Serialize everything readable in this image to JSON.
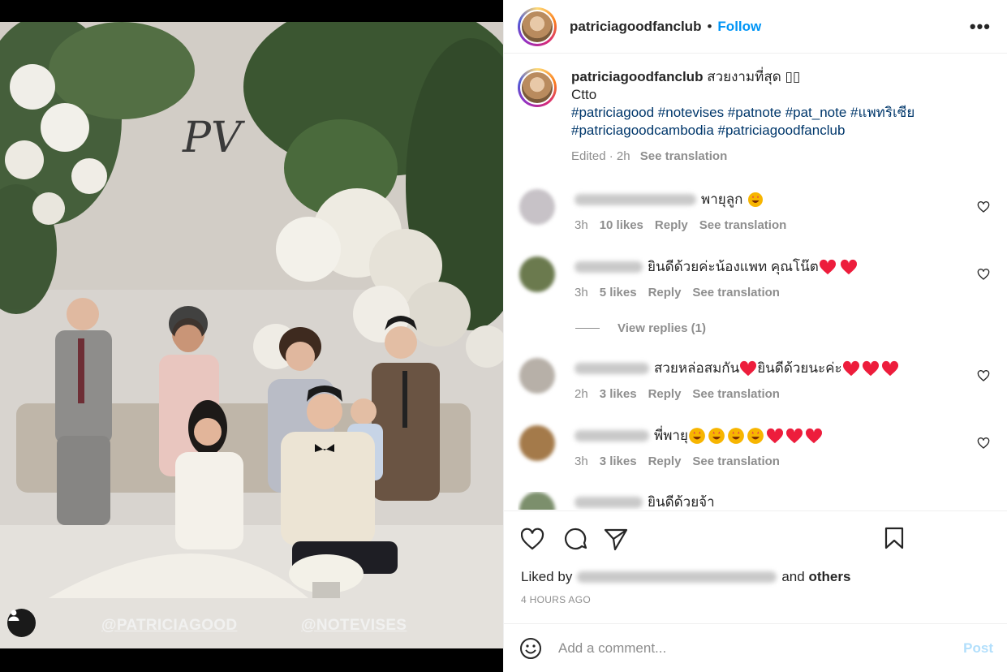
{
  "header": {
    "username": "patriciagoodfanclub",
    "separator": "•",
    "follow_label": "Follow",
    "more_label": "•••"
  },
  "media": {
    "watermark_left": "@PATRICIAGOOD",
    "watermark_right": "@NOTEVISES",
    "monogram": "PV"
  },
  "caption": {
    "username": "patriciagoodfanclub",
    "text": "สวยงามที่สุด ▯▯",
    "line2": "Ctto",
    "hashtags_line1": "#patriciagood #notevises #patnote #pat_note #แพทริเซีย",
    "hashtags_line2": "#patriciagoodcambodia #patriciagoodfanclub",
    "edited": "Edited · 2h",
    "see_translation": "See translation"
  },
  "comments": [
    {
      "text": "พายุลูก",
      "time": "3h",
      "likes": "10 likes",
      "reply": "Reply",
      "translate": "See translation",
      "avatar_color": "#c7c2c7"
    },
    {
      "text": "ยินดีด้วยค่ะน้องแพท คุณโน๊ต",
      "time": "3h",
      "likes": "5 likes",
      "reply": "Reply",
      "translate": "See translation",
      "avatar_color": "#6b7a4e"
    },
    {
      "text": "สวยหล่อสมกัน",
      "text2": "ยินดีด้วยนะค่ะ",
      "time": "2h",
      "likes": "3 likes",
      "reply": "Reply",
      "translate": "See translation",
      "avatar_color": "#b7b0a8"
    },
    {
      "text": "พี่พายุ",
      "time": "3h",
      "likes": "3 likes",
      "reply": "Reply",
      "translate": "See translation",
      "avatar_color": "#a47a4a"
    },
    {
      "text": "ยินดีด้วยจ้า",
      "avatar_color": "#7c8f6c"
    }
  ],
  "view_replies": "View replies (1)",
  "actions": {
    "liked_by": "Liked by",
    "and": "and",
    "others": "others",
    "time_ago": "4 HOURS AGO"
  },
  "add_comment": {
    "placeholder": "Add a comment...",
    "post_label": "Post"
  },
  "colors": {
    "accent": "#0095f6",
    "hashtag": "#00376b",
    "heart_red": "#ed1d3c",
    "secondary_text": "#8e8e8e"
  }
}
